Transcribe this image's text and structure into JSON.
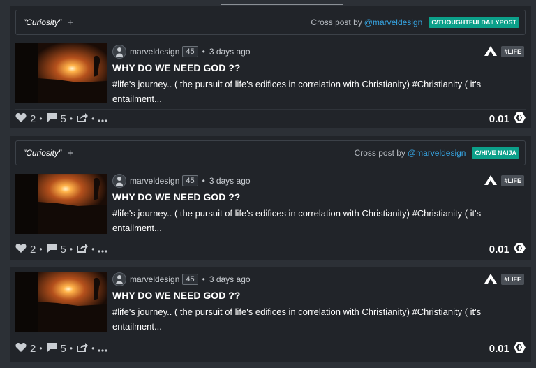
{
  "posts": [
    {
      "crosspost": {
        "title": "\"Curiosity\"",
        "plus": "+",
        "cross_text": "Cross post by",
        "cross_user": "@marveldesign",
        "community": "C/THOUGHTFULDAILYPOST"
      },
      "author": "marveldesign",
      "reputation": "45",
      "time": "3 days ago",
      "tag": "#LIFE",
      "title": "WHY DO WE NEED GOD ??",
      "excerpt": "#life's journey.. ( the pursuit of life's edifices in correlation with Christianity) #Christianity ( it's entailment...",
      "votes": "2",
      "comments": "5",
      "payout": "0.01"
    },
    {
      "crosspost": {
        "title": "\"Curiosity\"",
        "plus": "+",
        "cross_text": "Cross post by",
        "cross_user": "@marveldesign",
        "community": "C/HIVE NAIJA"
      },
      "author": "marveldesign",
      "reputation": "45",
      "time": "3 days ago",
      "tag": "#LIFE",
      "title": "WHY DO WE NEED GOD ??",
      "excerpt": "#life's journey.. ( the pursuit of life's edifices in correlation with Christianity) #Christianity ( it's entailment...",
      "votes": "2",
      "comments": "5",
      "payout": "0.01"
    },
    {
      "author": "marveldesign",
      "reputation": "45",
      "time": "3 days ago",
      "tag": "#LIFE",
      "title": "WHY DO WE NEED GOD ??",
      "excerpt": "#life's journey.. ( the pursuit of life's edifices in correlation with Christianity) #Christianity ( it's entailment...",
      "votes": "2",
      "comments": "5",
      "payout": "0.01"
    }
  ],
  "icons": {
    "vote": "heart-icon",
    "comment": "comment-icon",
    "reblog": "share-icon",
    "more": "more-icon",
    "community": "peakd-logo-icon",
    "currency": "hive-icon"
  },
  "colors": {
    "community_badge": "#0ca08a",
    "link": "#36a3e0",
    "card_bg": "#212429",
    "page_bg": "#2c3036"
  }
}
